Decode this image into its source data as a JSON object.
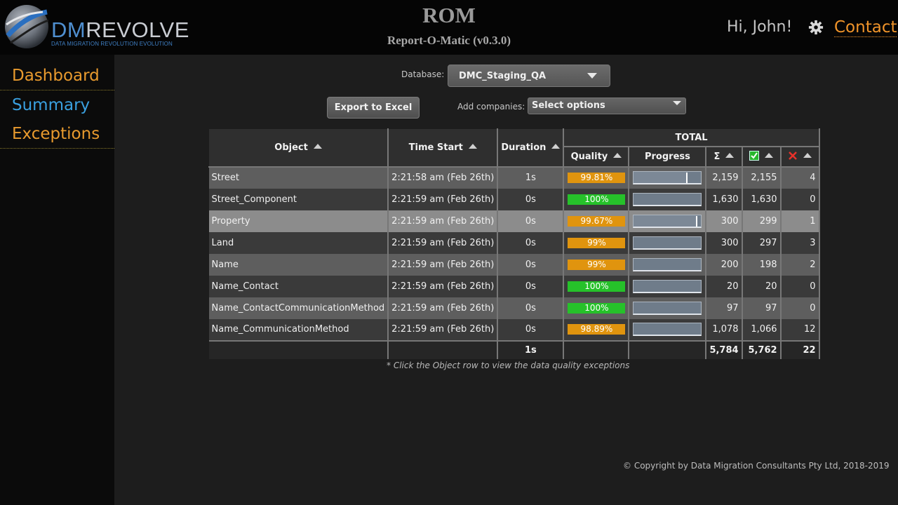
{
  "brand": {
    "logo_main_a": "DM",
    "logo_main_b": "REVOLVE",
    "logo_sub": "DATA MIGRATION REVOLUTION EVOLUTION"
  },
  "header": {
    "title": "ROM",
    "subtitle": "Report-O-Matic (v0.3.0)",
    "greeting": "Hi, John!",
    "contact": "Contact"
  },
  "sidebar": {
    "items": [
      {
        "label": "Dashboard"
      },
      {
        "label": "Summary"
      },
      {
        "label": "Exceptions"
      }
    ]
  },
  "controls": {
    "database_label": "Database:",
    "database_value": "DMC_Staging_QA",
    "export_label": "Export to Excel",
    "companies_label": "Add companies:",
    "companies_value": "Select options"
  },
  "table": {
    "headers": {
      "object": "Object",
      "time_start": "Time Start",
      "duration": "Duration",
      "total": "TOTAL",
      "quality": "Quality",
      "progress": "Progress",
      "sum": "Σ"
    },
    "rows": [
      {
        "object": "Street",
        "time": "2:21:58 am (Feb 26th)",
        "duration": "1s",
        "quality": "99.81%",
        "quality_status": "warn",
        "progress": 0.8,
        "total": "2,159",
        "passed": "2,155",
        "failed": "4"
      },
      {
        "object": "Street_Component",
        "time": "2:21:59 am (Feb 26th)",
        "duration": "0s",
        "quality": "100%",
        "quality_status": "ok",
        "progress": 0,
        "total": "1,630",
        "passed": "1,630",
        "failed": "0"
      },
      {
        "object": "Property",
        "time": "2:21:59 am (Feb 26th)",
        "duration": "0s",
        "quality": "99.67%",
        "quality_status": "warn",
        "progress": 0.94,
        "total": "300",
        "passed": "299",
        "failed": "1"
      },
      {
        "object": "Land",
        "time": "2:21:59 am (Feb 26th)",
        "duration": "0s",
        "quality": "99%",
        "quality_status": "warn",
        "progress": 0,
        "total": "300",
        "passed": "297",
        "failed": "3"
      },
      {
        "object": "Name",
        "time": "2:21:59 am (Feb 26th)",
        "duration": "0s",
        "quality": "99%",
        "quality_status": "warn",
        "progress": 0,
        "total": "200",
        "passed": "198",
        "failed": "2"
      },
      {
        "object": "Name_Contact",
        "time": "2:21:59 am (Feb 26th)",
        "duration": "0s",
        "quality": "100%",
        "quality_status": "ok",
        "progress": 0,
        "total": "20",
        "passed": "20",
        "failed": "0"
      },
      {
        "object": "Name_ContactCommunicationMethod",
        "time": "2:21:59 am (Feb 26th)",
        "duration": "0s",
        "quality": "100%",
        "quality_status": "ok",
        "progress": 0,
        "total": "97",
        "passed": "97",
        "failed": "0"
      },
      {
        "object": "Name_CommunicationMethod",
        "time": "2:21:59 am (Feb 26th)",
        "duration": "0s",
        "quality": "98.89%",
        "quality_status": "warn",
        "progress": 0,
        "total": "1,078",
        "passed": "1,066",
        "failed": "12"
      }
    ],
    "footer": {
      "duration": "1s",
      "total": "5,784",
      "passed": "5,762",
      "failed": "22"
    },
    "highlighted_row": 2
  },
  "note": "* Click the Object row to view the data quality exceptions",
  "copyright": "© Copyright by Data Migration Consultants Pty Ltd, 2018-2019",
  "colors": {
    "accent_orange": "#f0942a",
    "accent_blue": "#3aa0e0",
    "quality_warn": "#e0940e",
    "quality_ok": "#26c12a"
  },
  "icons": {
    "gear": "gear-icon",
    "passed": "check-icon",
    "failed": "cross-icon",
    "sort": "sort-arrow-icon"
  }
}
